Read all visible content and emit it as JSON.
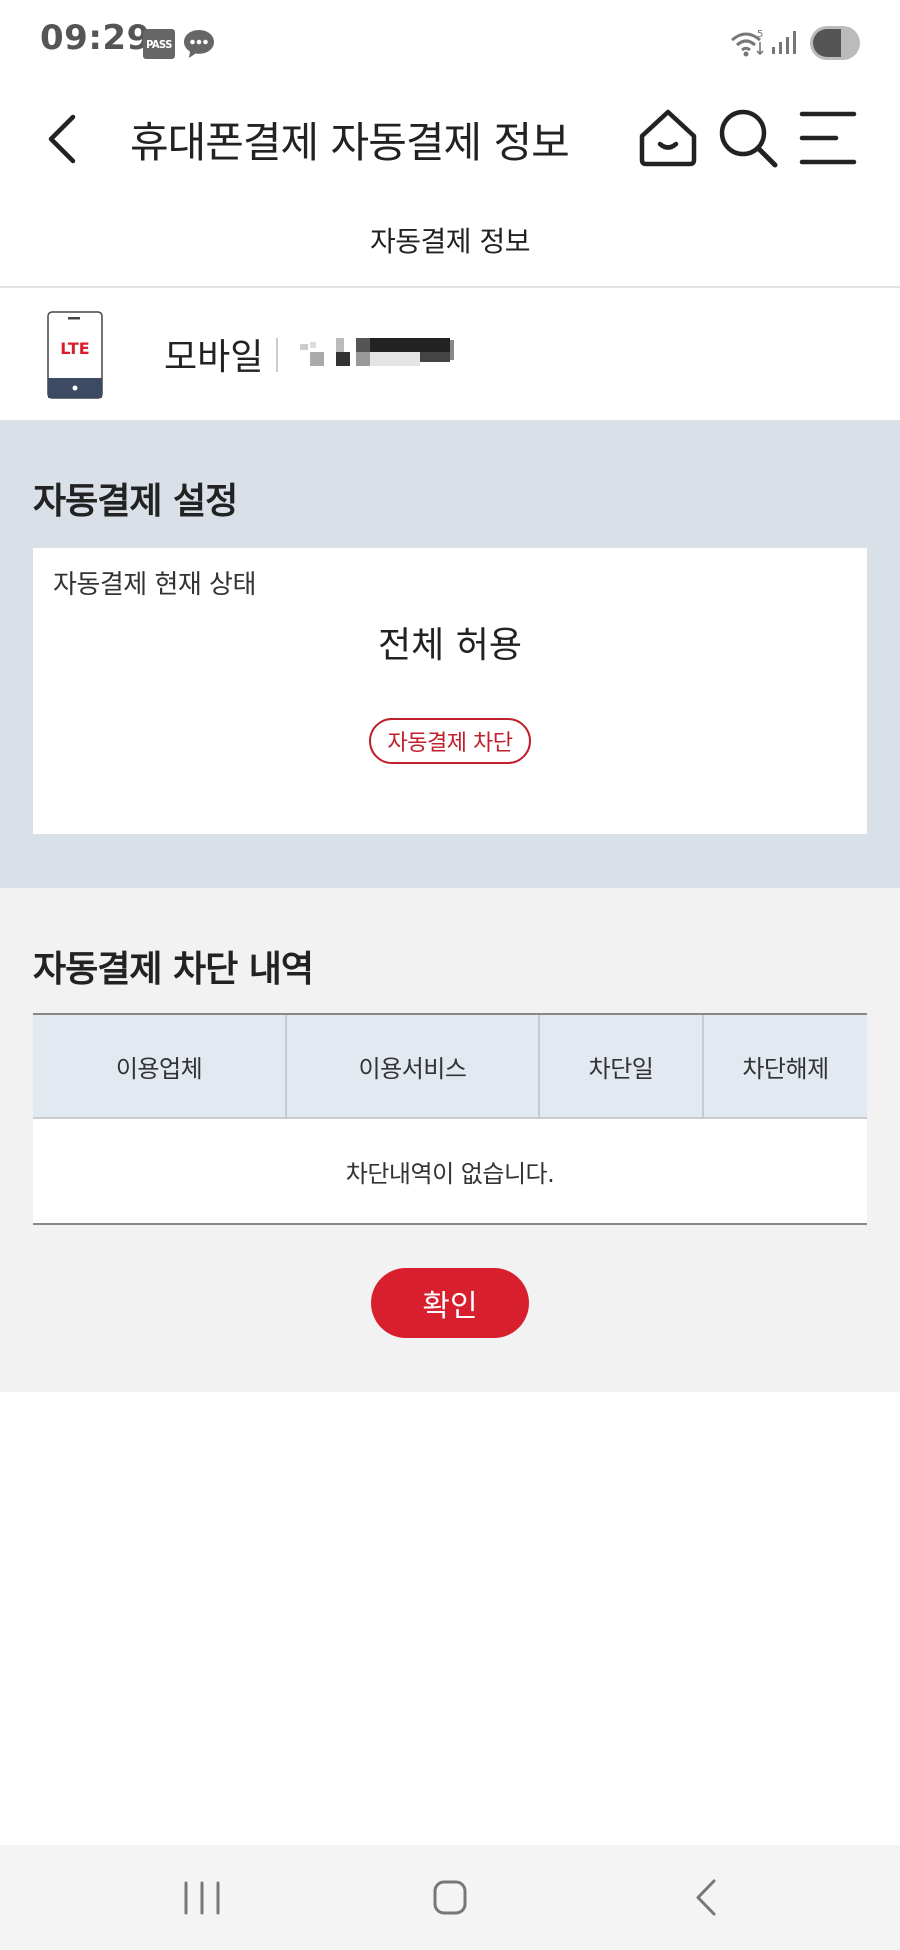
{
  "status_bar": {
    "time": "09:29",
    "pass_badge": "PASS",
    "icons": [
      "pass-icon",
      "chat-icon",
      "wifi-icon",
      "signal-icon",
      "toggle-icon"
    ]
  },
  "header": {
    "title": "휴대폰결제 자동결제 정보",
    "back_icon": "chevron-left-icon",
    "home_icon": "home-icon",
    "search_icon": "search-icon",
    "menu_icon": "menu-icon"
  },
  "subtitle": "자동결제 정보",
  "device": {
    "badge": "LTE",
    "label": "모바일",
    "number": "masked"
  },
  "auto_pay_setting": {
    "heading": "자동결제 설정",
    "status_label": "자동결제 현재 상태",
    "status_value": "전체 허용",
    "block_button": "자동결제 차단"
  },
  "block_history": {
    "heading": "자동결제 차단 내역",
    "columns": [
      "이용업체",
      "이용서비스",
      "차단일",
      "차단해제"
    ],
    "empty_message": "차단내역이 없습니다."
  },
  "confirm_button": "확인",
  "nav_bar": {
    "recent_icon": "recent-apps-icon",
    "home_icon": "nav-home-icon",
    "back_icon": "nav-back-icon"
  },
  "colors": {
    "accent_red": "#d81f2e",
    "outline_red": "#c0202b",
    "setting_bg": "#d9e0e8",
    "history_bg": "#f2f2f2",
    "table_header_bg": "#e3e9f1"
  }
}
